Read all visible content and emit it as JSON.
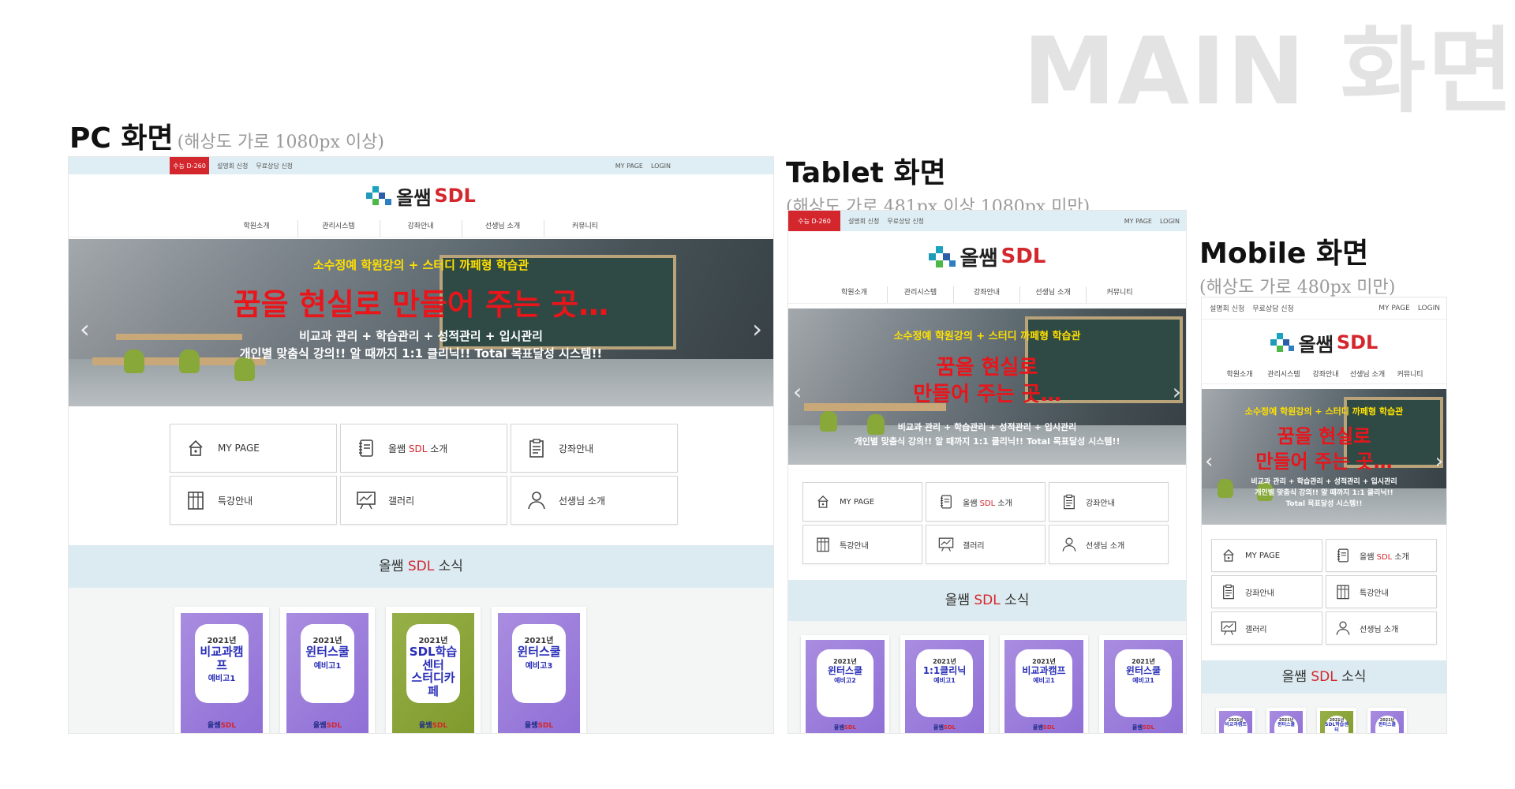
{
  "page_title": "MAIN 화면",
  "pc": {
    "heading": "PC 화면",
    "sub": "(해상도 가로 1080px 이상)"
  },
  "tablet": {
    "heading": "Tablet 화면",
    "sub": "(해상도 가로 481px 이상 1080px 미만)"
  },
  "mobile": {
    "heading": "Mobile 화면",
    "sub": "(해상도 가로 480px 미만)"
  },
  "topbar": {
    "dday": "수능 D-260",
    "link1": "설명회 신청",
    "link2": "무료상담 신청",
    "mypage": "MY PAGE",
    "login": "LOGIN"
  },
  "logo": {
    "text1": "올쌤",
    "text2": "SDL"
  },
  "nav": [
    "학원소개",
    "관리시스템",
    "강좌안내",
    "선생님 소개",
    "커뮤니티"
  ],
  "banner": {
    "line1": "소수정예 학원강의 + 스터디 까페형 학습관",
    "line2": "꿈을 현실로 만들어 주는 곳…",
    "line2a": "꿈을 현실로",
    "line2b": "만들어 주는 곳…",
    "line3": "비교과 관리 + 학습관리 + 성적관리 + 입시관리",
    "line4": "개인별 맞춤식 강의!! 알 때까지 1:1 클리닉!! Total 목표달성 시스템!!",
    "line4a": "개인별 맞춤식 강의!! 알 때까지 1:1 클리닉!!",
    "line4b": "Total 목표달성 시스템!!",
    "prev": "‹",
    "next": "›"
  },
  "menu": {
    "mypage": "MY PAGE",
    "intro_a": "올쌤 ",
    "intro_b": "SDL",
    "intro_c": " 소개",
    "courses": "강좌안내",
    "special": "특강안내",
    "gallery": "갤러리",
    "teachers": "선생님 소개"
  },
  "news": {
    "a": "올쌤 ",
    "b": "SDL",
    "c": " 소식"
  },
  "pc_cards": [
    {
      "year": "2021년",
      "title": "비교과캠프",
      "sub": "예비고1",
      "color": "purple"
    },
    {
      "year": "2021년",
      "title": "윈터스쿨",
      "sub": "예비고1",
      "color": "purple"
    },
    {
      "year": "2021년",
      "title": "SDL학습센터",
      "title2": "스터디카페",
      "sub": "",
      "color": "green"
    },
    {
      "year": "2021년",
      "title": "윈터스쿨",
      "sub": "예비고3",
      "color": "purple"
    }
  ],
  "tablet_cards": [
    {
      "year": "2021년",
      "title": "윈터스쿨",
      "sub": "예비고2"
    },
    {
      "year": "2021년",
      "title": "1:1클리닉",
      "sub": "예비고1"
    },
    {
      "year": "2021년",
      "title": "비교과캠프",
      "sub": "예비고1"
    },
    {
      "year": "2021년",
      "title": "윈터스쿨",
      "sub": "예비고1"
    }
  ],
  "mobile_cards": [
    {
      "year": "2021년",
      "title": "비교과캠프",
      "color": "purple"
    },
    {
      "year": "2021년",
      "title": "윈터스쿨",
      "color": "purple"
    },
    {
      "year": "2021년",
      "title": "SDL학습센터",
      "color": "green"
    },
    {
      "year": "2021년",
      "title": "윈터스쿨",
      "color": "purple"
    }
  ],
  "card_brand_a": "올쌤",
  "card_brand_b": "SDL",
  "colors": {
    "red": "#d4262d",
    "topbar": "#dfeef4",
    "news": "#dcebf1",
    "purple": "#9a7ddb",
    "green": "#8aa53a",
    "card_text": "#2a2fb8"
  },
  "icons": [
    "lock-icon",
    "notebook-icon",
    "clipboard-icon",
    "building-icon",
    "easel-icon",
    "person-icon"
  ]
}
